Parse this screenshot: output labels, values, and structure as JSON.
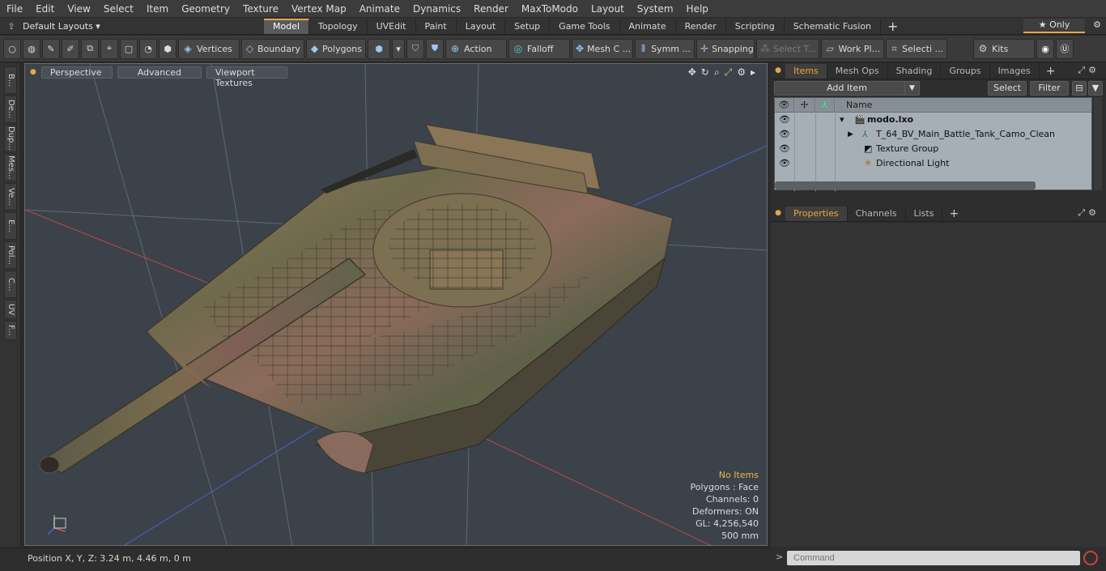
{
  "menu": [
    "File",
    "Edit",
    "View",
    "Select",
    "Item",
    "Geometry",
    "Texture",
    "Vertex Map",
    "Animate",
    "Dynamics",
    "Render",
    "MaxToModo",
    "Layout",
    "System",
    "Help"
  ],
  "layouts": {
    "default_label": "Default Layouts ▾",
    "tabs": [
      "Model",
      "Topology",
      "UVEdit",
      "Paint",
      "Layout",
      "Setup",
      "Game Tools",
      "Animate",
      "Render",
      "Scripting",
      "Schematic Fusion"
    ],
    "active_tab": "Model",
    "only_label": "★ Only"
  },
  "toolbar": {
    "vertices": "Vertices",
    "boundary": "Boundary",
    "polygons": "Polygons",
    "action": "Action",
    "falloff": "Falloff",
    "mesh": "Mesh C ...",
    "symm": "Symm ...",
    "snapping": "Snapping",
    "select_t": "Select T...",
    "work_plane": "Work Pl...",
    "selection": "Selecti ...",
    "kits": "Kits"
  },
  "left_tabs": [
    "B...",
    "De...",
    "Dup...",
    "Mes...",
    "Ve...",
    "E...",
    "Pol...",
    "C...",
    "UV",
    "F..."
  ],
  "viewport": {
    "buttons": [
      "Perspective",
      "Advanced",
      "Viewport Textures"
    ],
    "hud": {
      "no_items": "No Items",
      "polygons": "Polygons : Face",
      "channels": "Channels: 0",
      "deformers": "Deformers: ON",
      "gl": "GL: 4,256,540",
      "scale": "500 mm"
    }
  },
  "status": {
    "position": "Position X, Y, Z:   3.24 m, 4.46 m, 0 m"
  },
  "items_panel": {
    "tabs": [
      "Items",
      "Mesh Ops",
      "Shading",
      "Groups",
      "Images"
    ],
    "active_tab": "Items",
    "add_item": "Add Item",
    "select": "Select",
    "filter": "Filter",
    "column_name": "Name",
    "rows": [
      {
        "name": "modo.lxo",
        "indent": 0,
        "icon": "scene-icon"
      },
      {
        "name": "T_64_BV_Main_Battle_Tank_Camo_Clean",
        "indent": 1,
        "icon": "mesh-icon"
      },
      {
        "name": "Texture Group",
        "indent": 1,
        "icon": "texture-group-icon"
      },
      {
        "name": "Directional Light",
        "indent": 1,
        "icon": "light-icon"
      }
    ]
  },
  "properties_panel": {
    "tabs": [
      "Properties",
      "Channels",
      "Lists"
    ],
    "active_tab": "Properties"
  },
  "command": {
    "placeholder": "Command"
  },
  "colors": {
    "accent": "#e5a64a",
    "viewport_bg": "#3b424a",
    "item_list_bg": "#a6aeb6"
  }
}
